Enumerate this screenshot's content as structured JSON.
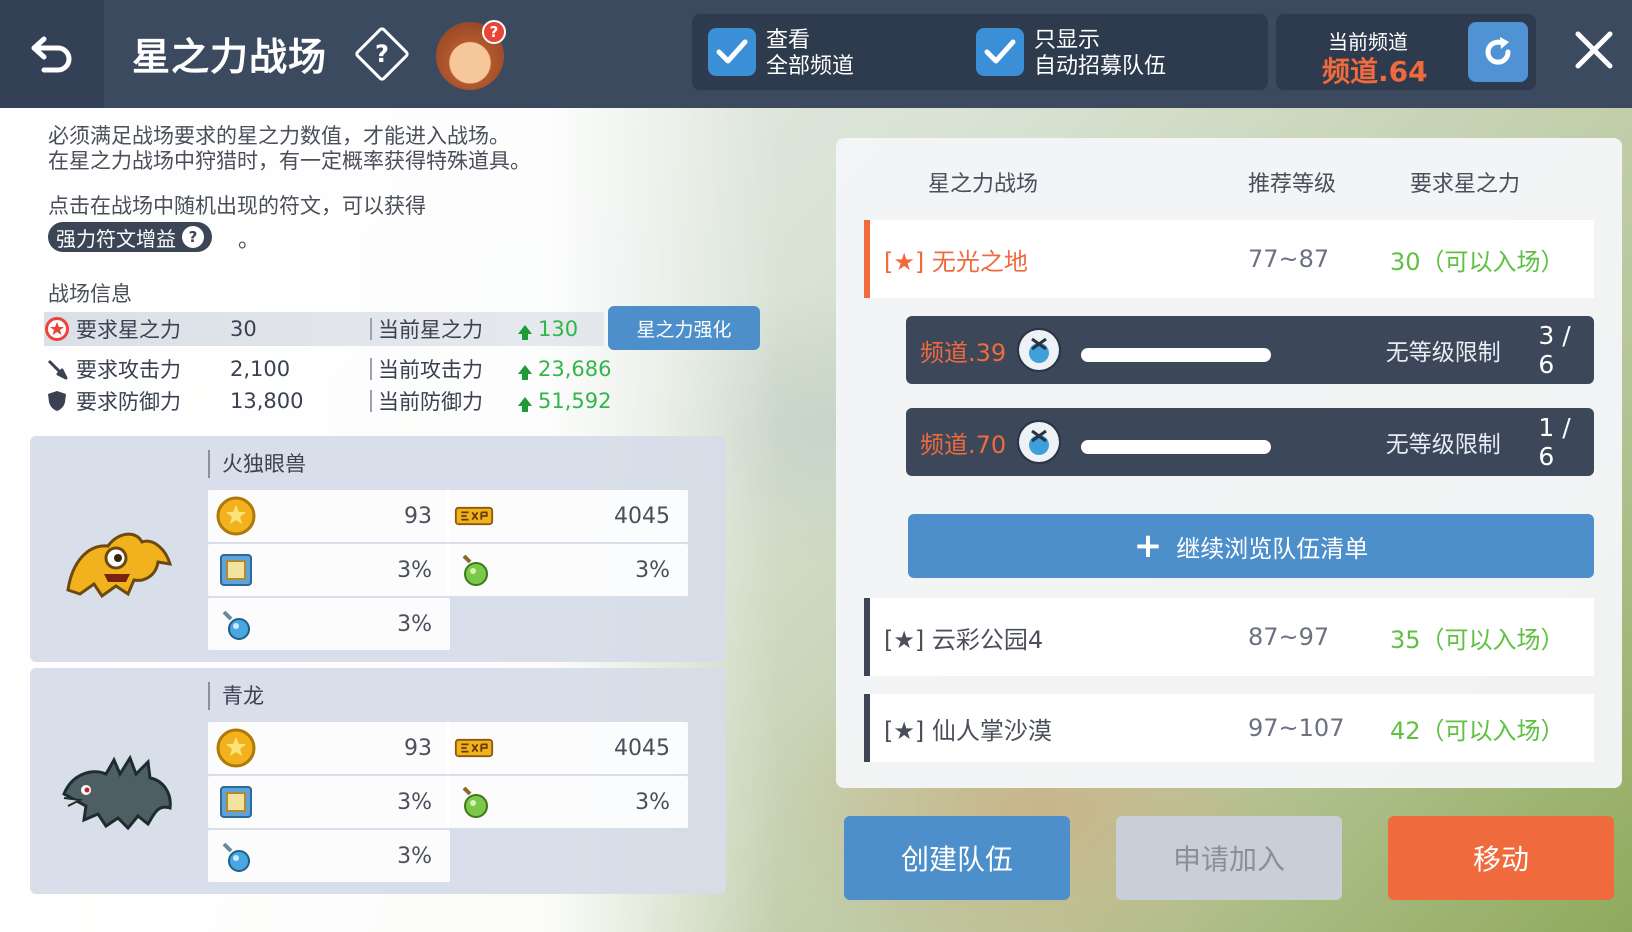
{
  "header": {
    "title": "星之力战场",
    "filters": [
      {
        "line1": "查看",
        "line2": "全部频道",
        "checked": true
      },
      {
        "line1": "只显示",
        "line2": "自动招募队伍",
        "checked": true
      }
    ],
    "channel_label": "当前频道",
    "channel_value": "频道.64"
  },
  "left": {
    "desc_line1": "必须满足战场要求的星之力数值，才能进入战场。",
    "desc_line2": "在星之力战场中狩猎时，有一定概率获得特殊道具。",
    "desc_line3": "点击在战场中随机出现的符文，可以获得",
    "rune_chip": "强力符文增益",
    "rune_dot": "。",
    "section_label": "战场信息",
    "stats": [
      {
        "icon": "star-badge-icon",
        "name": "要求星之力",
        "value": "30",
        "current_label": "当前星之力",
        "current_value": "130"
      },
      {
        "icon": "sword-icon",
        "name": "要求攻击力",
        "value": "2,100",
        "current_label": "当前攻击力",
        "current_value": "23,686"
      },
      {
        "icon": "shield-icon",
        "name": "要求防御力",
        "value": "13,800",
        "current_label": "当前防御力",
        "current_value": "51,592"
      }
    ],
    "enhance_label": "星之力强化",
    "monsters": [
      {
        "name": "火独眼兽",
        "gold": "93",
        "exp": "4045",
        "scroll": "3%",
        "potion": "3%",
        "bottle": "3%"
      },
      {
        "name": "青龙",
        "gold": "93",
        "exp": "4045",
        "scroll": "3%",
        "potion": "3%",
        "bottle": "3%"
      }
    ]
  },
  "right": {
    "columns": [
      "星之力战场",
      "推荐等级",
      "要求星之力"
    ],
    "fields": [
      {
        "name": "[★] 无光之地",
        "level": "77~87",
        "requirement": "30（可以入场）",
        "active": true
      },
      {
        "name": "[★] 云彩公园4",
        "level": "87~97",
        "requirement": "35（可以入场）",
        "active": false
      },
      {
        "name": "[★] 仙人掌沙漠",
        "level": "97~107",
        "requirement": "42（可以入场）",
        "active": false
      }
    ],
    "parties": [
      {
        "channel": "频道.39",
        "limit": "无等级限制",
        "count": "3 / 6"
      },
      {
        "channel": "频道.70",
        "limit": "无等级限制",
        "count": "1 / 6"
      }
    ],
    "browse_label": "继续浏览队伍清单"
  },
  "buttons": {
    "create": "创建队伍",
    "apply": "申请加入",
    "move": "移动"
  },
  "colors": {
    "header": "#3c4a60",
    "accent_blue": "#4d8fcb",
    "accent_orange": "#ef6a3c",
    "green": "#5fc141"
  }
}
